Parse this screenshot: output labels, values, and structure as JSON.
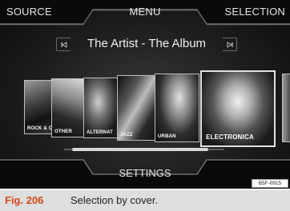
{
  "topbar": {
    "source_label": "SOURCE",
    "menu_label": "MENU",
    "selection_label": "SELECTION"
  },
  "now_playing": {
    "title": "The Artist - The Album"
  },
  "icons": {
    "prev": "skip-previous-icon",
    "next": "skip-next-icon"
  },
  "covers": [
    {
      "label": "ROCK & O"
    },
    {
      "label": "OTHER"
    },
    {
      "label": "ALTERNAT"
    },
    {
      "label": "JAZZ"
    },
    {
      "label": "URBAN"
    },
    {
      "label": "ELECTRONICA"
    }
  ],
  "bottombar": {
    "settings_label": "SETTINGS"
  },
  "image_code": "B5F-0915",
  "caption": {
    "figure": "Fig. 206",
    "text": "Selection by cover."
  },
  "colors": {
    "accent": "#d24a1a",
    "caption_bg": "#dedede",
    "screen_bg": "#1d1d1d"
  }
}
